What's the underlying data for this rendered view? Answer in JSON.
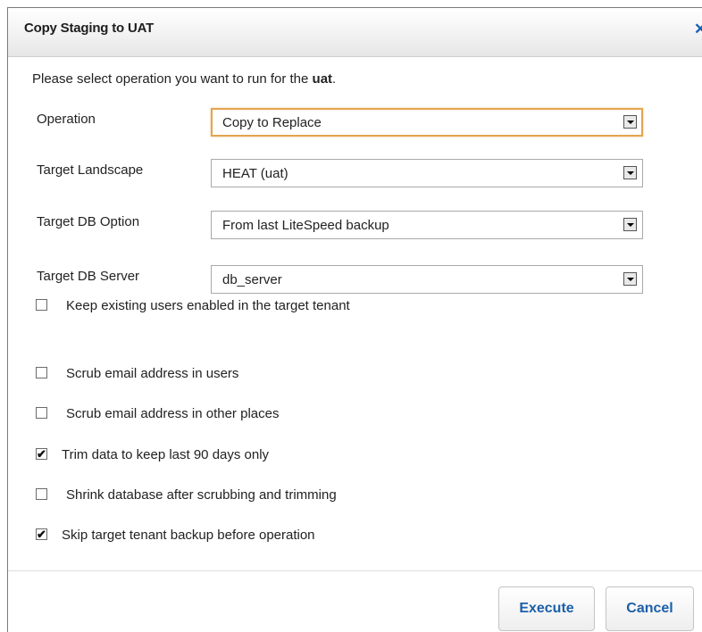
{
  "dialog": {
    "title": "Copy Staging to UAT",
    "close_icon": "close-icon",
    "intro_prefix": "Please select operation you want to run for the ",
    "intro_env": "uat",
    "intro_suffix": "."
  },
  "fields": {
    "operation": {
      "label": "Operation",
      "value": "Copy to Replace"
    },
    "target_landscape": {
      "label": "Target Landscape",
      "value": "HEAT (uat)"
    },
    "target_db_option": {
      "label": "Target DB Option",
      "value": "From last LiteSpeed backup"
    },
    "target_db_server": {
      "label": "Target DB Server",
      "value": "db_server"
    }
  },
  "options": [
    {
      "label": "Keep existing users enabled in the target tenant",
      "checked": false
    },
    {
      "label": "Scrub email address in users",
      "checked": false
    },
    {
      "label": "Scrub email address in other places",
      "checked": false
    },
    {
      "label": "Trim data to keep last 90 days only",
      "checked": true
    },
    {
      "label": "Shrink database after scrubbing and trimming",
      "checked": false
    },
    {
      "label": "Skip target tenant backup before operation",
      "checked": true
    }
  ],
  "buttons": {
    "execute": "Execute",
    "cancel": "Cancel"
  },
  "colors": {
    "button_text": "#1c5fa8",
    "focus_border": "#e3a552",
    "close_icon": "#1a5fb4"
  }
}
